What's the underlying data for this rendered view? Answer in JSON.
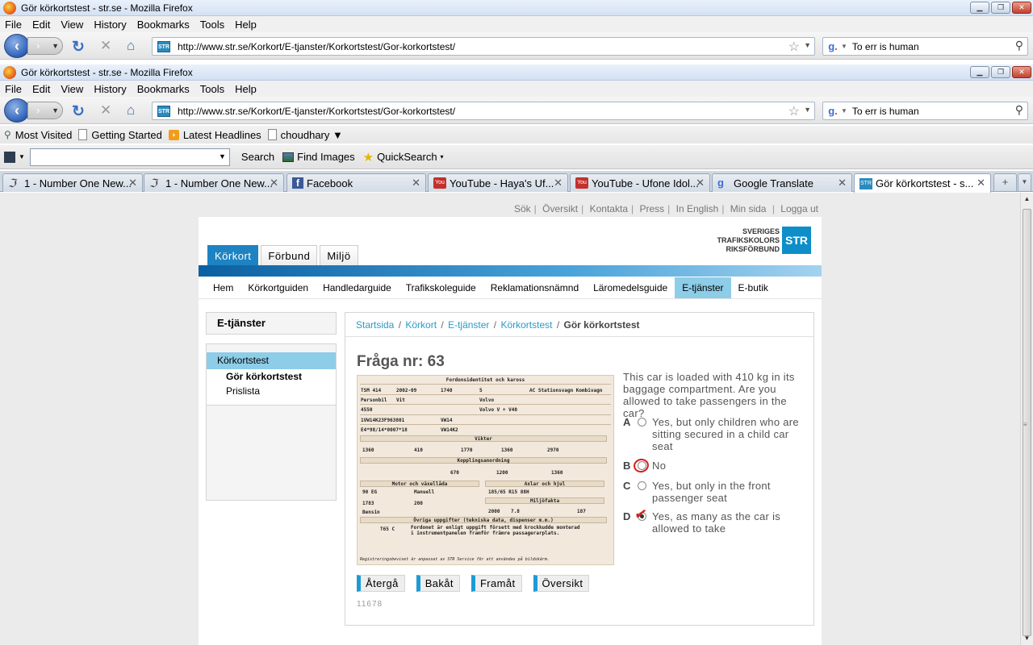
{
  "window": {
    "title": "Gör körkortstest - str.se - Mozilla Firefox"
  },
  "menu": [
    "File",
    "Edit",
    "View",
    "History",
    "Bookmarks",
    "Tools",
    "Help"
  ],
  "nav": {
    "url": "http://www.str.se/Korkort/E-tjanster/Korkortstest/Gor-korkortstest/",
    "search_value": "To err is human",
    "site_icon": "STR"
  },
  "bookmarks": {
    "items": [
      "Most Visited",
      "Getting Started",
      "Latest Headlines",
      "choudhary ▼"
    ]
  },
  "toolbar2": {
    "search": "Search",
    "find_images": "Find Images",
    "quicksearch": "QuickSearch"
  },
  "tabs": [
    {
      "label": "1 - Number One New...",
      "icon": "n1"
    },
    {
      "label": "1 - Number One New...",
      "icon": "n1"
    },
    {
      "label": "Facebook",
      "icon": "facebook"
    },
    {
      "label": "YouTube - Haya's Uf...",
      "icon": "youtube"
    },
    {
      "label": "YouTube - Ufone Idol...",
      "icon": "youtube"
    },
    {
      "label": "Google Translate",
      "icon": "google"
    },
    {
      "label": "Gör körkortstest - s...",
      "icon": "str"
    }
  ],
  "site": {
    "toplinks": [
      "Sök",
      "Översikt",
      "Kontakta",
      "Press",
      "In English",
      "Min sida",
      "Logga ut"
    ],
    "logo": {
      "line1": "SVERIGES",
      "line2": "TRAFIKSKOLORS",
      "line3": "RIKSFÖRBUND",
      "mark": "STR"
    },
    "maintabs": [
      "Körkort",
      "Förbund",
      "Miljö"
    ],
    "subnav": [
      "Hem",
      "Körkortguiden",
      "Handledarguide",
      "Trafikskoleguide",
      "Reklamationsnämnd",
      "Läromedelsguide",
      "E-tjänster",
      "E-butik"
    ],
    "subnav_active": "E-tjänster",
    "side": {
      "heading": "E-tjänster",
      "current": "Körkortstest",
      "sub1": "Gör körkortstest",
      "sub2": "Prislista"
    },
    "breadcrumb": [
      "Startsida",
      "Körkort",
      "E-tjänster",
      "Körkortstest"
    ],
    "breadcrumb_current": "Gör körkortstest",
    "question_title": "Fråga nr: 63",
    "question_text": "This car is loaded with 410 kg in its baggage compartment. Are you allowed to take passengers in the car?",
    "answers": [
      {
        "letter": "A",
        "text": "Yes, but only children who are sitting secured in a child car seat",
        "checked": false
      },
      {
        "letter": "B",
        "text": "No",
        "checked": false
      },
      {
        "letter": "C",
        "text": "Yes, but only in the front passenger seat",
        "checked": false
      },
      {
        "letter": "D",
        "text": "Yes, as many as the car is allowed to take",
        "checked": true
      }
    ],
    "buttons": [
      "Återgå",
      "Bakåt",
      "Framåt",
      "Översikt"
    ],
    "code": "11678",
    "doc": {
      "header": "Fordonsidentitet och kaross",
      "reg": "TSM 414",
      "date": "2002-09",
      "weight": "1740",
      "seats": "5",
      "body": "AC Stationsvagn Kombivagn",
      "type": "Personbil",
      "color": "Vit",
      "make": "Volvo",
      "model": "Volvo V + V40",
      "num": "4550",
      "vin": "1VW14K23F963801",
      "code1": "VW14",
      "approval": "E4*98/14*0007*18",
      "code2": "VW14K2",
      "weights_title": "Vikter",
      "w1": "1360",
      "w2": "410",
      "w3": "1770",
      "w4": "1360",
      "w5": "2970",
      "coupling_title": "Kopplingsanordning",
      "c1": "670",
      "c2": "1200",
      "c3": "1360",
      "engine_title": "Motor och växellåda",
      "axle_title": "Axlar och hjul",
      "fuel_code": "90 EG",
      "gearbox": "Manuell",
      "tyre": "185/65 R15 88H",
      "env_title": "Miljöfakta",
      "cc": "1783",
      "kw": "200",
      "fuel": "Bensin",
      "m1": "2000",
      "m2": "7.8",
      "m3": "187",
      "other_title": "Övriga uppgifter (tekniska data, dispenser m.m.)",
      "t65": "T65 C",
      "t65_text": "Fordonet är enligt uppgift försett med krockkudde monterad i instrumentpanelen framför främre passagerarplats.",
      "footnote": "Registreringsbeviset är anpassat av STR Service för att användas på bildskärm."
    }
  }
}
